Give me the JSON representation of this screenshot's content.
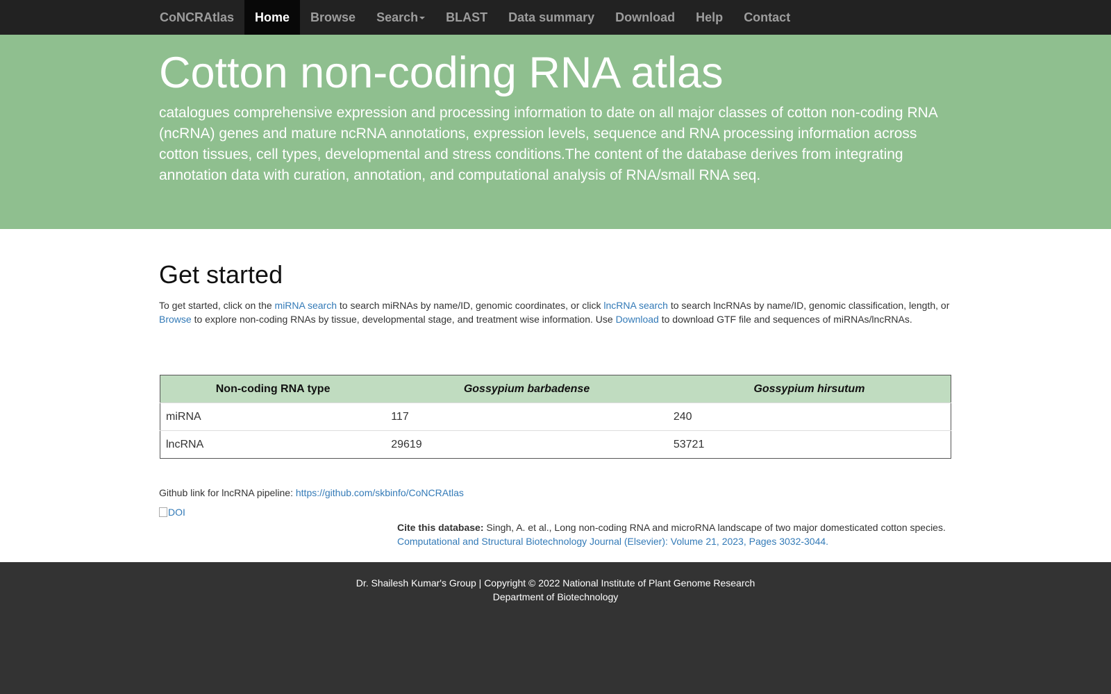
{
  "nav": {
    "brand": "CoNCRAtlas",
    "items": [
      {
        "label": "Home",
        "active": true
      },
      {
        "label": "Browse"
      },
      {
        "label": "Search",
        "dropdown": true
      },
      {
        "label": "BLAST"
      },
      {
        "label": "Data summary"
      },
      {
        "label": "Download"
      },
      {
        "label": "Help"
      },
      {
        "label": "Contact"
      }
    ]
  },
  "jumbotron": {
    "title": "Cotton non-coding RNA atlas",
    "text": "catalogues comprehensive expression and processing information to date on all major classes of cotton non-coding RNA (ncRNA) genes and mature ncRNA annotations, expression levels, sequence and RNA processing information across cotton tissues, cell types, developmental and stress conditions.The content of the database derives from integrating annotation data with curation, annotation, and computational analysis of RNA/small RNA seq."
  },
  "get_started": {
    "heading": "Get started",
    "t1": "To get started, click on the ",
    "link_mirna": "miRNA search",
    "t2": " to search miRNAs by name/ID, genomic coordinates, or click ",
    "link_lncrna": "lncRNA search",
    "t3": " to search lncRNAs by name/ID, genomic classification, length, or ",
    "link_browse": "Browse",
    "t4": " to explore non-coding RNAs by tissue, developmental stage, and treatment wise information. Use ",
    "link_download": "Download",
    "t5": " to download GTF file and sequences of miRNAs/lncRNAs."
  },
  "table": {
    "headers": [
      "Non-coding RNA type",
      "Gossypium barbadense",
      "Gossypium hirsutum"
    ],
    "rows": [
      [
        "miRNA",
        "117",
        "240"
      ],
      [
        "lncRNA",
        "29619",
        "53721"
      ]
    ]
  },
  "github": {
    "label": "Github link for lncRNA pipeline: ",
    "url": "https://github.com/skbinfo/CoNCRAtlas"
  },
  "doi": {
    "alt": "DOI"
  },
  "cite": {
    "label": "Cite this database:",
    "text": " Singh, A. et al., Long non-coding RNA and microRNA landscape of two major domesticated cotton species.",
    "journal": "Computational and Structural Biotechnology Journal (Elsevier): Volume 21, 2023, Pages 3032-3044."
  },
  "footer": {
    "line1": "Dr. Shailesh Kumar's Group | Copyright © 2022 National Institute of Plant Genome Research",
    "line2": "Department of Biotechnology"
  },
  "colors": {
    "navbar": "#222222",
    "jumbotron": "#8fbf8f",
    "table_header": "#c0dcc0",
    "link": "#337ab7",
    "footer": "#333333"
  }
}
